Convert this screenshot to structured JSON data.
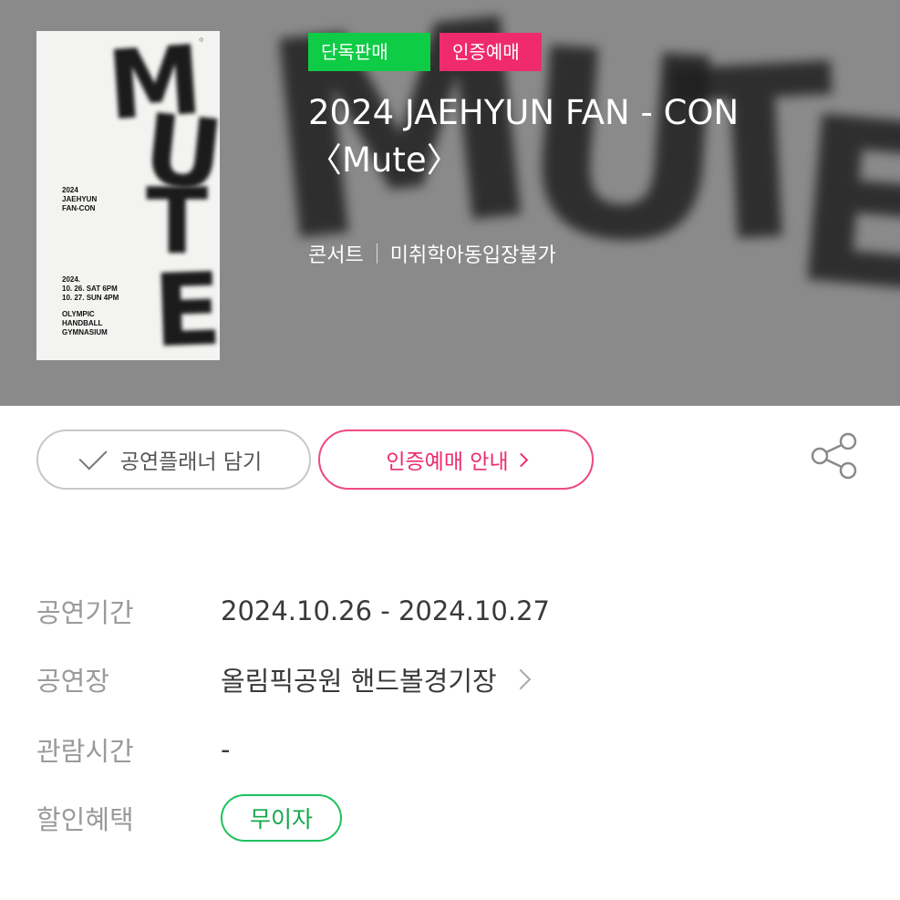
{
  "hero": {
    "background_text": "MUTE",
    "badges": {
      "exclusive": "단독판매",
      "verified": "인증예매"
    },
    "title_line1": "2024 JAEHYUN FAN - CON",
    "title_line2": "〈Mute〉",
    "genre": "콘서트",
    "age_rating": "미취학아동입장불가",
    "colors": {
      "exclusive_badge": "#0fcc46",
      "verified_badge": "#ef2b6e"
    }
  },
  "poster": {
    "big_text": "MUTE",
    "title": "2024\nJAEHYUN\nFAN-CON",
    "dates": "2024.\n10. 26. SAT 6PM\n10. 27. SUN 4PM",
    "venue": "OLYMPIC\nHANDBALL\nGYMNASIUM"
  },
  "actions": {
    "planner_label": "공연플래너 담기",
    "verify_label": "인증예매 안내",
    "share_icon": "share-icon"
  },
  "info": {
    "period_label": "공연기간",
    "period_value": "2024.10.26 - 2024.10.27",
    "venue_label": "공연장",
    "venue_value": "올림픽공원 핸드볼경기장",
    "duration_label": "관람시간",
    "duration_value": "-",
    "discount_label": "할인혜택",
    "discount_value": "무이자"
  }
}
